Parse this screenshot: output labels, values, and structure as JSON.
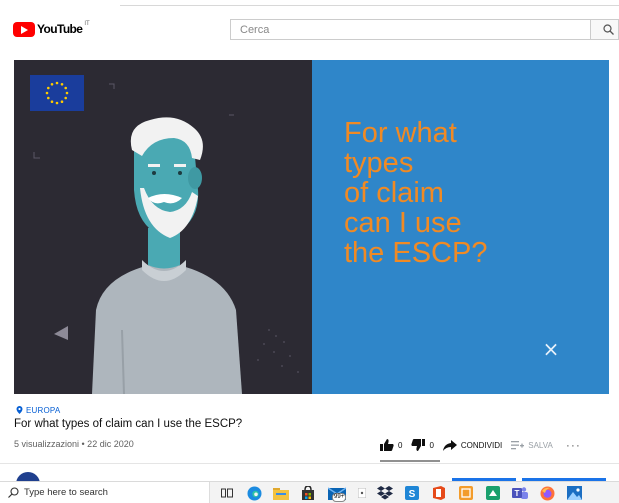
{
  "header": {
    "logo_text": "YouTube",
    "region": "IT",
    "search_placeholder": "Cerca"
  },
  "video": {
    "headline_lines": [
      "For what",
      "types",
      "of claim",
      "can I use",
      "the ESCP?"
    ],
    "close_glyph": "×"
  },
  "info": {
    "channel": "EUROPA",
    "title": "For what types of claim can I use the ESCP?",
    "meta": "5 visualizzazioni • 22 dic 2020",
    "likes": "0",
    "dislikes": "0",
    "share_label": "CONDIVIDI",
    "save_label": "SALVA",
    "more_glyph": "···"
  },
  "taskbar": {
    "search_text": "Type here to search",
    "mail_badge": "99+",
    "icons": [
      "task-view-icon",
      "edge-icon",
      "file-explorer-icon",
      "store-icon",
      "mail-icon",
      "app-icon",
      "dropbox-icon",
      "sway-icon",
      "office-icon",
      "app-orange-icon",
      "app-green-icon",
      "teams-icon",
      "firefox-icon",
      "photos-icon"
    ]
  },
  "colors": {
    "brand_red": "#ff0000",
    "video_blue": "#2f86c9",
    "video_dark": "#2c2a33",
    "headline_orange": "#f08a24",
    "link_blue": "#065fd4"
  }
}
